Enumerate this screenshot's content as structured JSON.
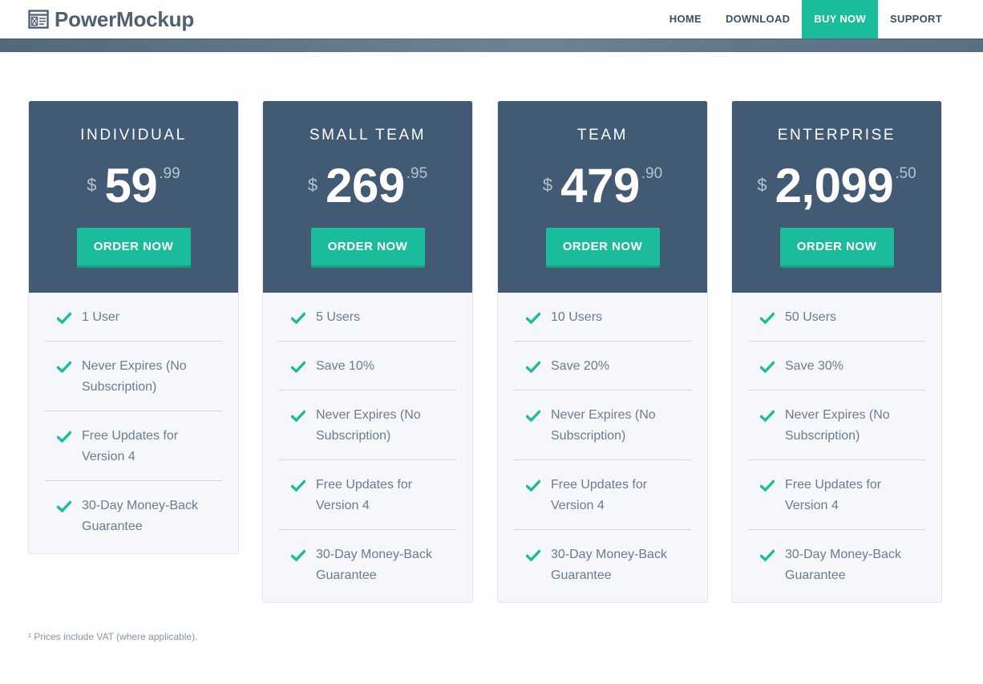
{
  "header": {
    "brand": "PowerMockup",
    "logo_icon": "window-mockup-icon",
    "nav": [
      {
        "label": "HOME",
        "active": false
      },
      {
        "label": "DOWNLOAD",
        "active": false
      },
      {
        "label": "BUY NOW",
        "active": true
      },
      {
        "label": "SUPPORT",
        "active": false
      }
    ]
  },
  "colors": {
    "accent": "#1abc9c",
    "card_header": "#425a73",
    "card_body": "#f5f7fa",
    "brand_text": "#4f6072"
  },
  "plans": [
    {
      "name": "INDIVIDUAL",
      "currency": "$",
      "price": "59",
      "cents": ".99",
      "button": "ORDER NOW",
      "features": [
        "1 User",
        "Never Expires (No Subscription)",
        "Free Updates for Version 4",
        "30-Day Money-Back Guarantee"
      ]
    },
    {
      "name": "SMALL TEAM",
      "currency": "$",
      "price": "269",
      "cents": ".95",
      "button": "ORDER NOW",
      "features": [
        "5 Users",
        "Save 10%",
        "Never Expires (No Subscription)",
        "Free Updates for Version 4",
        "30-Day Money-Back Guarantee"
      ]
    },
    {
      "name": "TEAM",
      "currency": "$",
      "price": "479",
      "cents": ".90",
      "button": "ORDER NOW",
      "features": [
        "10 Users",
        "Save 20%",
        "Never Expires (No Subscription)",
        "Free Updates for Version 4",
        "30-Day Money-Back Guarantee"
      ]
    },
    {
      "name": "ENTERPRISE",
      "currency": "$",
      "price": "2,099",
      "cents": ".50",
      "button": "ORDER NOW",
      "features": [
        "50 Users",
        "Save 30%",
        "Never Expires (No Subscription)",
        "Free Updates for Version 4",
        "30-Day Money-Back Guarantee"
      ]
    }
  ],
  "footnote": "¹ Prices include VAT (where applicable)."
}
